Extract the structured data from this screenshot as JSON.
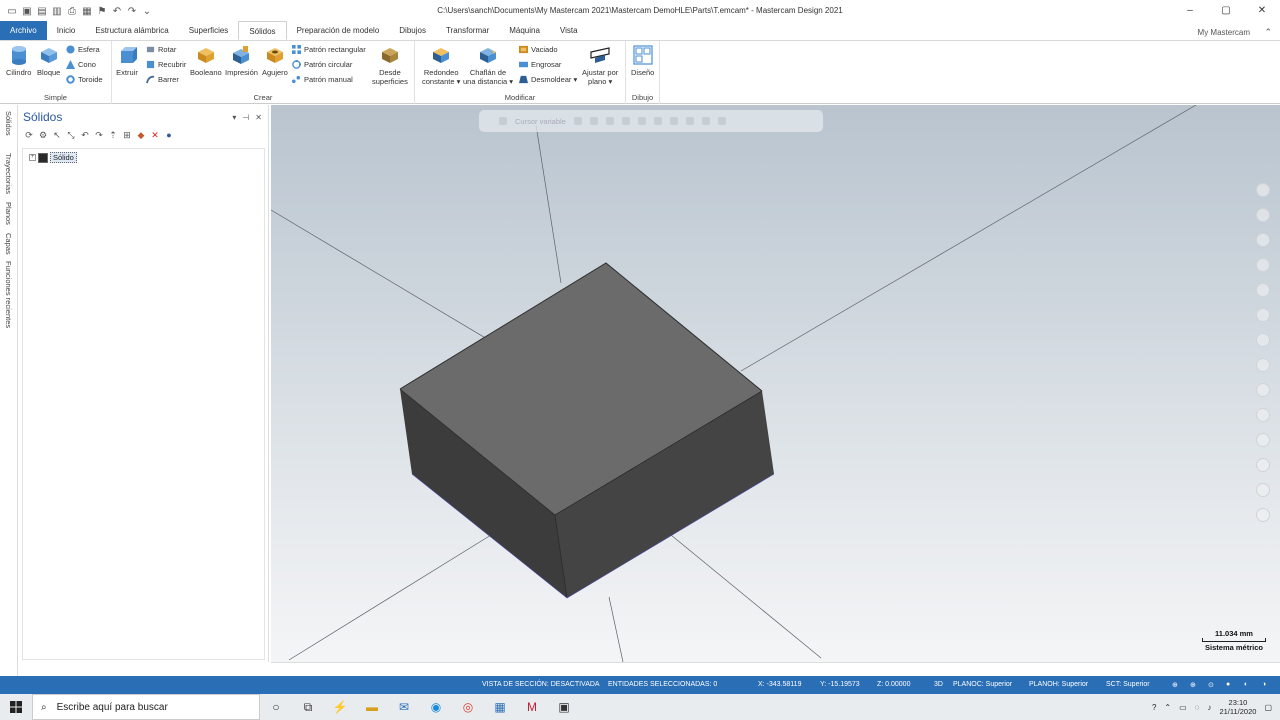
{
  "window": {
    "title": "C:\\Users\\sanch\\Documents\\My Mastercam 2021\\Mastercam DemoHLE\\Parts\\T.emcam* - Mastercam Design 2021",
    "minimize": "–",
    "restore": "▢",
    "close": "✕"
  },
  "tabs": [
    "Archivo",
    "Inicio",
    "Estructura alámbrica",
    "Superficies",
    "Sólidos",
    "Preparación de modelo",
    "Dibujos",
    "Transformar",
    "Máquina",
    "Vista"
  ],
  "active_tab": "Sólidos",
  "my_mastercam": "My Mastercam",
  "ribbon": {
    "simple": {
      "title": "Simple",
      "cilindro": "Cilindro",
      "bloque": "Bloque",
      "esfera": "Esfera",
      "cono": "Cono",
      "toroide": "Toroide"
    },
    "crear": {
      "title": "Crear",
      "extruir": "Extruir",
      "rotar": "Rotar",
      "recubrir": "Recubrir",
      "barrer": "Barrer",
      "booleano": "Booleano",
      "impresion": "Impresión",
      "agujero": "Agujero",
      "patron_rect": "Patrón rectangular",
      "patron_circ": "Patrón circular",
      "patron_manual": "Patrón manual",
      "desde_sup_1": "Desde",
      "desde_sup_2": "superficies"
    },
    "modificar": {
      "title": "Modificar",
      "redondeo_1": "Redondeo",
      "redondeo_2": "constante ▾",
      "chaflan_1": "Chaflán de",
      "chaflan_2": "una distancia ▾",
      "vaciado": "Vaciado",
      "engrosar": "Engrosar",
      "desmoldear": "Desmoldear ▾",
      "ajustar_1": "Ajustar por",
      "ajustar_2": "plano ▾"
    },
    "dibujo": {
      "title": "Dibujo",
      "diseno": "Diseño"
    }
  },
  "side_tabs": [
    "Sólidos",
    "Trayectorias",
    "Planos",
    "Capas",
    "Funciones recientes"
  ],
  "panel": {
    "title": "Sólidos",
    "tree_item": "Sólido"
  },
  "viewport": {
    "toolbar_label": "Cursor variable",
    "scale_value": "11.034 mm",
    "scale_system": "Sistema métrico"
  },
  "status": {
    "section_view": "VISTA DE SECCIÓN: DESACTIVADA",
    "selected": "ENTIDADES SELECCIONADAS: 0",
    "x": "X: -343.58119",
    "y": "Y: -15.19573",
    "z": "Z: 0.00000",
    "mode": "3D",
    "planoc": "PLANOC: Superior",
    "planoh": "PLANOH: Superior",
    "sct": "SCT: Superior"
  },
  "taskbar": {
    "search_placeholder": "Escribe aquí para buscar",
    "time": "23:10",
    "date": "21/11/2020"
  },
  "colors": {
    "accent": "#2a6eb5",
    "solid_top": "#6a6a6a",
    "solid_side": "#3e3e3e"
  }
}
